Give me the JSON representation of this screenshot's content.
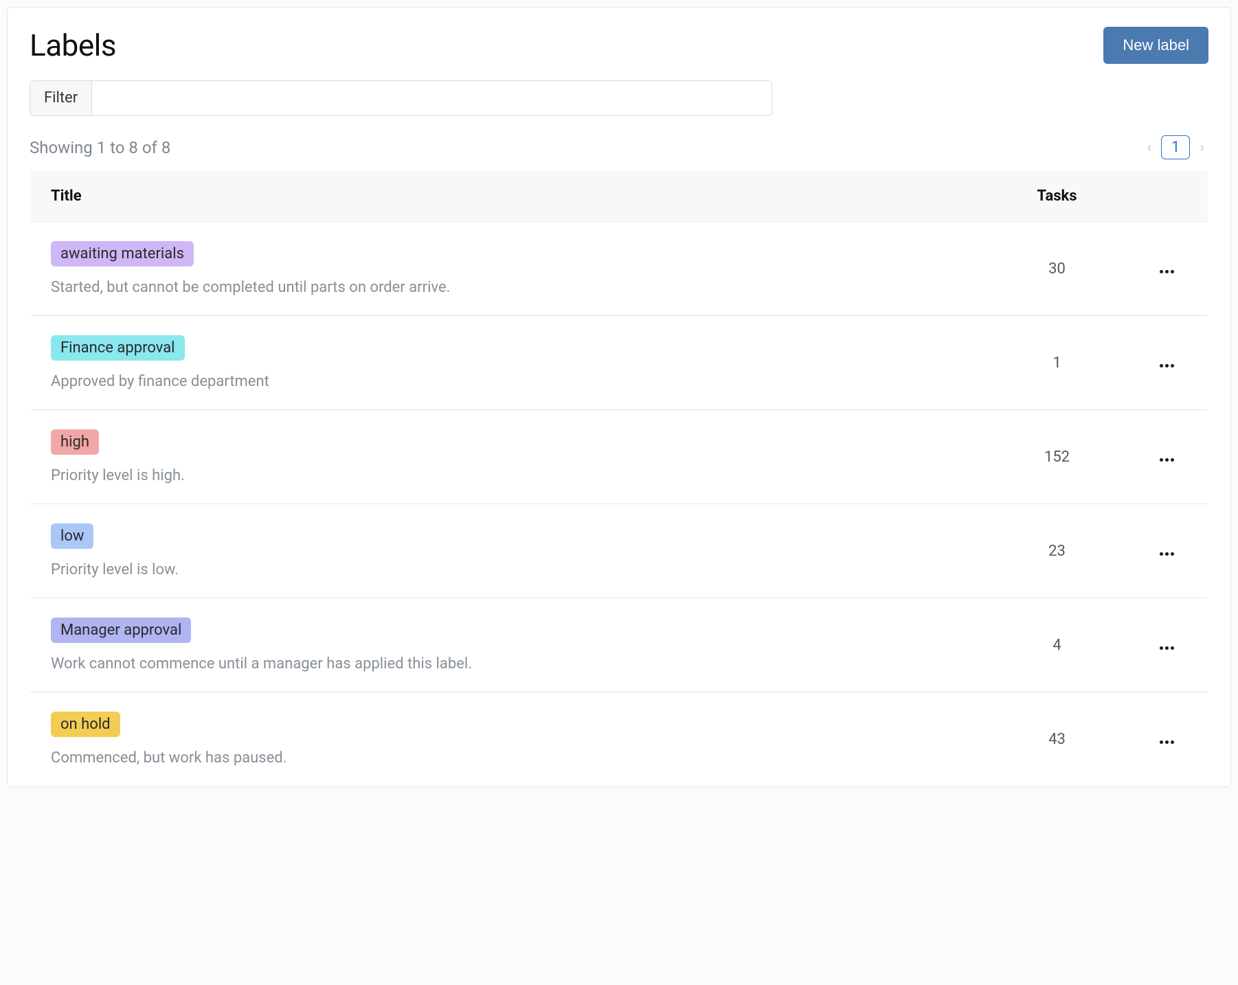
{
  "header": {
    "title": "Labels",
    "new_label_btn": "New label"
  },
  "filter": {
    "label": "Filter",
    "value": ""
  },
  "summary": "Showing 1 to 8 of 8",
  "pagination": {
    "current": "1"
  },
  "columns": {
    "title": "Title",
    "tasks": "Tasks"
  },
  "rows": [
    {
      "label": "awaiting materials",
      "desc": "Started, but cannot be completed until parts on order arrive.",
      "tasks": "30",
      "color": "#cfb7f7"
    },
    {
      "label": "Finance approval",
      "desc": "Approved by finance department",
      "tasks": "1",
      "color": "#8ae7ee"
    },
    {
      "label": "high",
      "desc": "Priority level is high.",
      "tasks": "152",
      "color": "#f1a7a7"
    },
    {
      "label": "low",
      "desc": "Priority level is low.",
      "tasks": "23",
      "color": "#a9c7f7"
    },
    {
      "label": "Manager approval",
      "desc": "Work cannot commence until a manager has applied this label.",
      "tasks": "4",
      "color": "#b0b4f2"
    },
    {
      "label": "on hold",
      "desc": "Commenced, but work has paused.",
      "tasks": "43",
      "color": "#f3cc53"
    }
  ]
}
